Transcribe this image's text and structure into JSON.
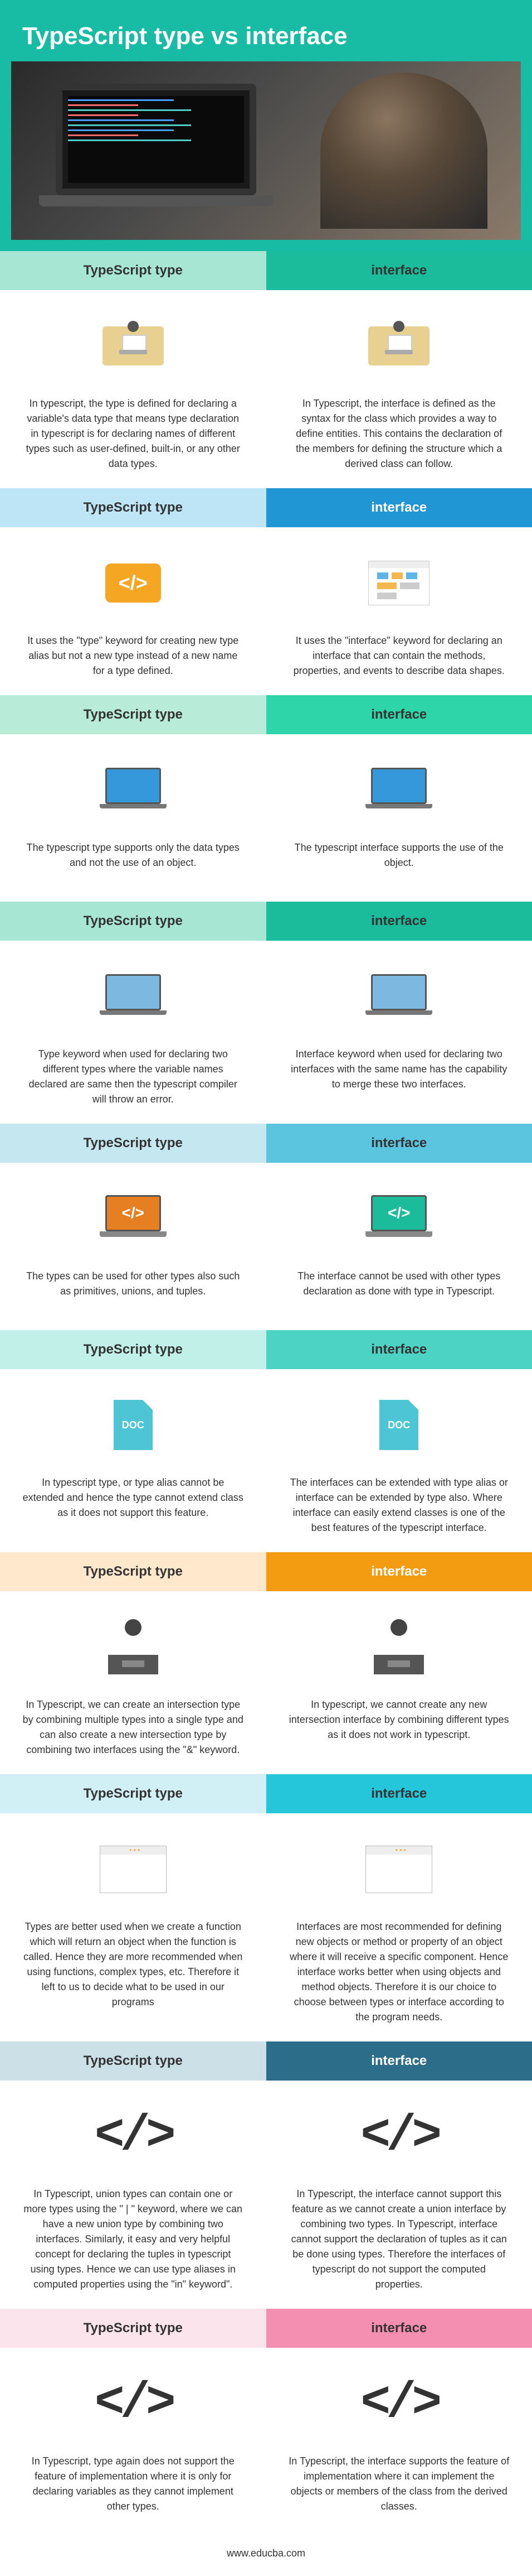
{
  "title": "TypeScript type vs interface",
  "footer": "www.educba.com",
  "col_left": "TypeScript type",
  "col_right": "interface",
  "rows": [
    {
      "left": "In typescript, the type is defined for declaring a variable's data type that means type declaration in typescript is for declaring names of different types such as user-defined, built-in, or any other data types.",
      "right": "In Typescript, the interface is defined as the syntax for the class which provides a way to define entities. This contains the declaration of the members for defining the structure which a derived class can follow."
    },
    {
      "left": "It uses the \"type\" keyword for creating new type alias but not a new type instead of a new name for a type defined.",
      "right": "It uses the \"interface\" keyword for declaring an interface that can contain the methods, properties, and events to describe data shapes."
    },
    {
      "left": "The typescript type supports only the data types and not the use of an object.",
      "right": "The typescript interface supports the use of the object."
    },
    {
      "left": "Type keyword when used for declaring two different types where the variable names declared are same then the typescript compiler will throw an error.",
      "right": "Interface keyword when used for declaring two interfaces with the same name has the capability to merge these two interfaces."
    },
    {
      "left": "The types can be used for other types also such as primitives, unions, and tuples.",
      "right": "The interface cannot be used with other types declaration as done with type in Typescript."
    },
    {
      "left": "In typescript type, or type alias cannot be extended and hence the type cannot extend class as it does not support this feature.",
      "right": "The interfaces can be extended with type alias or interface can be extended by type also. Where interface can easily extend classes is one of the best features of the typescript interface."
    },
    {
      "left": "In Typescript, we can create an intersection type by combining multiple types into a single type and can also create a new intersection type by combining two interfaces using the \"&\" keyword.",
      "right": "In typescript, we cannot create any new intersection interface by combining different types as it does not work in typescript."
    },
    {
      "left": "Types are better used when we create a function which will return an object when the function is called. Hence they are more recommended when using functions, complex types, etc. Therefore it left to us to decide what to be used in our programs",
      "right": "Interfaces are most recommended for defining new objects or method or property of an object where it will receive a specific component. Hence interface works better when using objects and method objects. Therefore it is our choice to choose between types or interface according to the program needs."
    },
    {
      "left": "In Typescript, union types can contain one or more types using the \" | \" keyword, where we can have a new union type by combining two interfaces. Similarly, it easy and very helpful concept for declaring the tuples in typescript using types. Hence we can use type aliases in computed properties using the \"in\" keyword\".",
      "right": "In Typescript, the interface cannot support this feature as we cannot create a union interface by combining two types. In Typescript, interface cannot support the declaration of tuples as it can be done using types. Therefore the interfaces of typescript do not support the computed properties."
    },
    {
      "left": "In Typescript, type again does not support the feature of implementation where it is only for declaring variables as they cannot implement other types.",
      "right": "In Typescript, the interface supports the feature of implementation where it can implement the objects or members of the class from the derived classes."
    }
  ]
}
